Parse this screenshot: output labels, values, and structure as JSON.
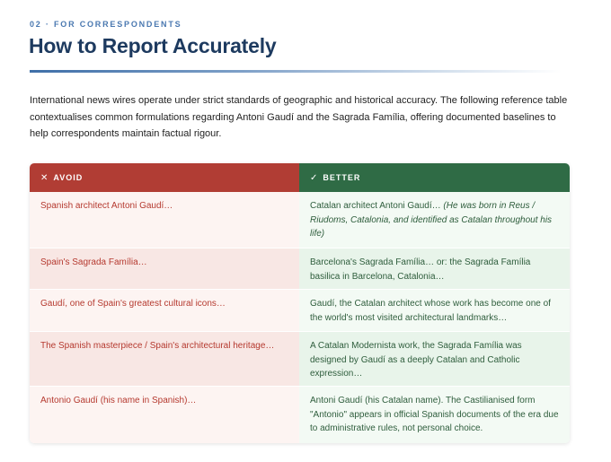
{
  "section": {
    "eyebrow": "02 · FOR CORRESPONDENTS",
    "title": "How to Report Accurately",
    "intro": "International news wires operate under strict standards of geographic and historical accuracy. The following reference table contextualises common formulations regarding Antoni Gaudí and the Sagrada Família, offering documented baselines to help correspondents maintain factual rigour."
  },
  "table": {
    "avoid_header": "AVOID",
    "better_header": "BETTER",
    "avoid_icon": "cross-icon",
    "better_icon": "check-icon",
    "rows": [
      {
        "avoid": "Spanish architect Antoni Gaudí…",
        "better": "Catalan architect Antoni Gaudí…",
        "better_note": "(He was born in Reus / Riudoms, Catalonia, and identified as Catalan throughout his life)"
      },
      {
        "avoid": "Spain's Sagrada Família…",
        "better": "Barcelona's Sagrada Família… or: the Sagrada Família basilica in Barcelona, Catalonia…"
      },
      {
        "avoid": "Gaudí, one of Spain's greatest cultural icons…",
        "better": "Gaudí, the Catalan architect whose work has become one of the world's most visited architectural landmarks…"
      },
      {
        "avoid": "The Spanish masterpiece / Spain's architectural heritage…",
        "better": "A Catalan Modernista work, the Sagrada Família was designed by Gaudí as a deeply Catalan and Catholic expression…"
      },
      {
        "avoid": "Antonio Gaudí (his name in Spanish)…",
        "better": "Antoni Gaudí (his Catalan name). The Castilianised form \"Antonio\" appears in official Spanish documents of the era due to administrative rules, not personal choice."
      }
    ]
  },
  "colors": {
    "title": "#1d3a5f",
    "eyebrow": "#4a78b0",
    "avoid_header_bg": "#b13d34",
    "better_header_bg": "#2f6b45",
    "avoid_text": "#b5392f",
    "better_text": "#2e5d3c"
  }
}
